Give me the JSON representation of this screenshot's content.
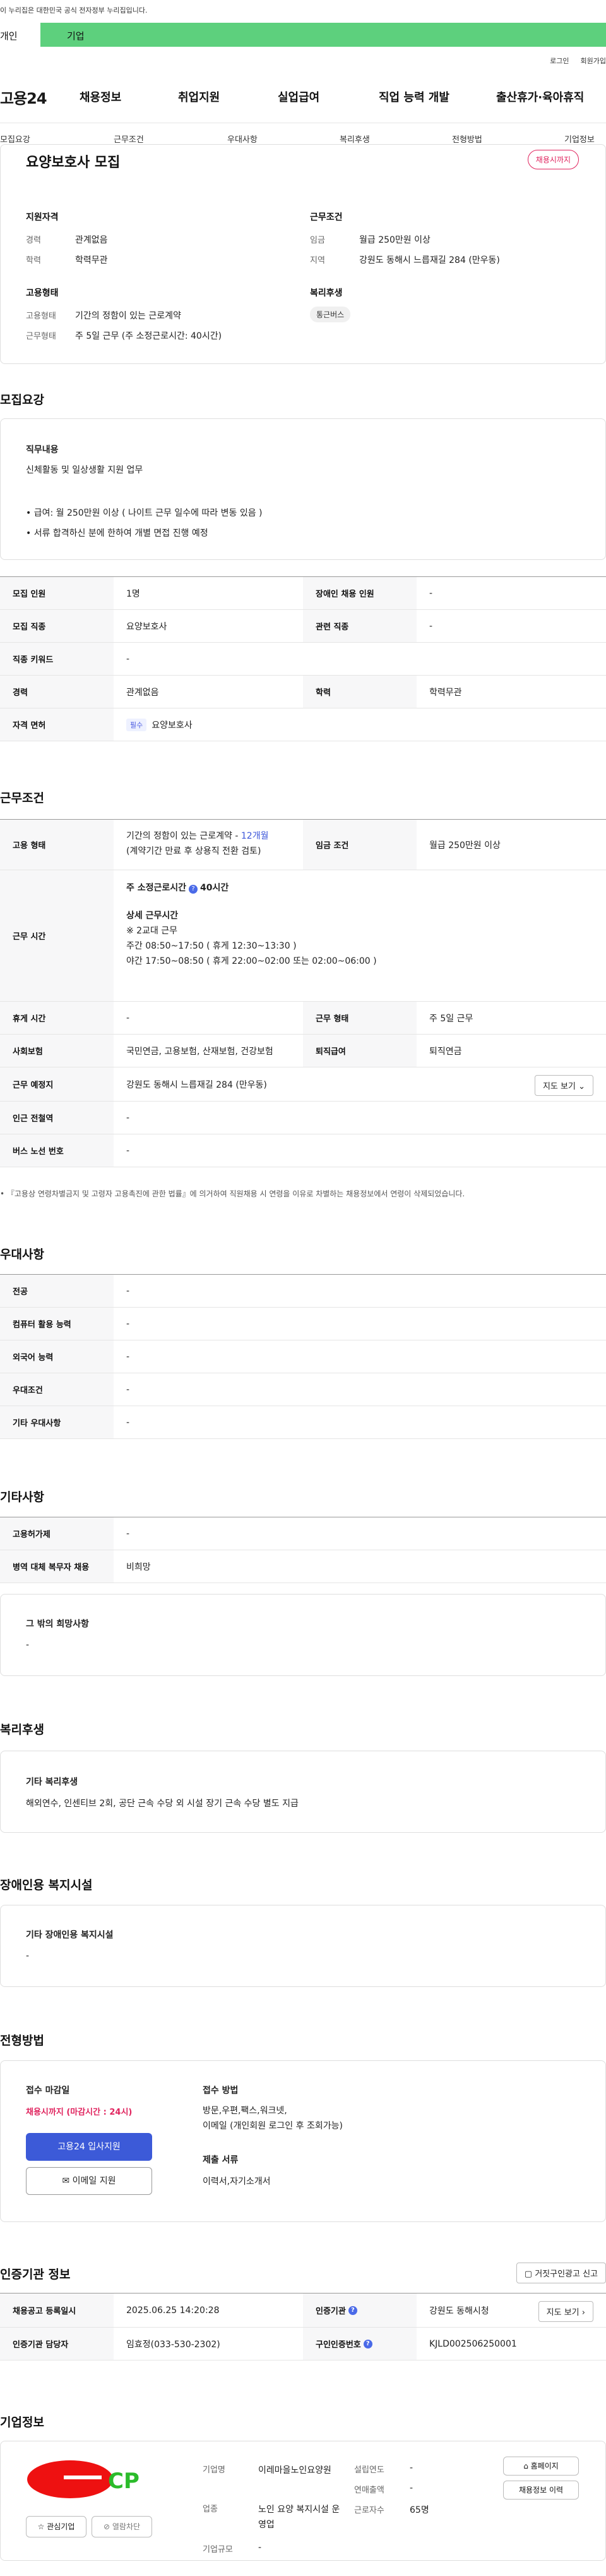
{
  "gov_banner": "이 누리집은 대한민국 공식 전자정부 누리집입니다.",
  "user_tabs": {
    "personal": "개인",
    "company": "기업"
  },
  "top_util": {
    "login": "로그인",
    "join": "회원가입"
  },
  "logo": "고용24",
  "gnb": [
    "채용정보",
    "취업지원",
    "실업급여",
    "직업 능력 개발",
    "출산휴가·육아휴직"
  ],
  "subnav": [
    "모집요강",
    "근무조건",
    "우대사항",
    "복리후생",
    "전형방법",
    "기업정보"
  ],
  "summary": {
    "title": "요양보호사 모집",
    "badge": "채용시까지",
    "support_title": "지원자격",
    "exp_label": "경력",
    "exp": "관계없음",
    "edu_label": "학력",
    "edu": "학력무관",
    "work_title": "근무조건",
    "wage_label": "임금",
    "wage": "월급 250만원 이상",
    "area_label": "지역",
    "area": "강원도 동해시 느릅재길 284 (만우동)",
    "emp_title": "고용형태",
    "emptype_label": "고용형태",
    "emptype": "기간의 정함이 있는 근로계약",
    "worktype_label": "근무형태",
    "worktype": "주 5일 근무 (주 소정근로시간: 40시간)",
    "welfare_title": "복리후생",
    "welfare_chip": "통근버스"
  },
  "recruit": {
    "title": "모집요강",
    "duty_title": "직무내용",
    "duty": "신체활동 및 일상생활 지원 업무",
    "bullet1": "• 급여: 월 250만원 이상 ( 나이트 근무 일수에 따라 변동 있음 )",
    "bullet2": "• 서류 합격하신 분에 한하여 개별 면접 진행 예정",
    "rows": [
      {
        "l": "모집 인원",
        "v": "1명",
        "l2": "장애인 채용 인원",
        "v2": "-"
      },
      {
        "l": "모집 직종",
        "v": "요양보호사",
        "l2": "관련 직종",
        "v2": "-"
      },
      {
        "l": "직종 키워드",
        "v": "-"
      },
      {
        "l": "경력",
        "v": "관계없음",
        "l2": "학력",
        "v2": "학력무관"
      }
    ],
    "license_label": "자격 면허",
    "license_tag": "필수",
    "license": "요양보호사"
  },
  "conditions": {
    "title": "근무조건",
    "emp_label": "고용 형태",
    "emp_line1": "기간의 정함이 있는 근로계약 - ",
    "emp_months": "12개월",
    "emp_line2": "(계약기간 만료 후 상용직 전환 검토)",
    "wage_label": "임금 조건",
    "wage": "월급 250만원 이상",
    "time_label": "근무 시간",
    "time_weekly_label": "주 소정근로시간",
    "time_weekly": "40시간",
    "time_detail_title": "상세 근무시간",
    "time_detail1": "※ 2교대 근무",
    "time_detail2": "주간 08:50~17:50 ( 휴게 12:30~13:30 )",
    "time_detail3": "야간 17:50~08:50 ( 휴게 22:00~02:00 또는 02:00~06:00 )",
    "rest_label": "휴게 시간",
    "rest": "-",
    "form_label": "근무 형태",
    "form": "주 5일 근무",
    "ins_label": "사회보험",
    "ins": "국민연금, 고용보험, 산재보험, 건강보험",
    "pension_label": "퇴직급여",
    "pension": "퇴직연금",
    "place_label": "근무 예정지",
    "place": "강원도 동해시 느릅재길 284 (만우동)",
    "map_btn": "지도 보기",
    "subway_label": "인근 전철역",
    "subway": "-",
    "bus_label": "버스 노선 번호",
    "bus": "-",
    "note": "• 『고용상 연령차별금지 및 고령자 고용촉진에 관한 법률』에 의거하여 직원채용 시 연령을 이유로 차별하는 채용정보에서 연령이 삭제되었습니다."
  },
  "pref": {
    "title": "우대사항",
    "rows": [
      {
        "l": "전공",
        "v": "-"
      },
      {
        "l": "컴퓨터 활용 능력",
        "v": "-"
      },
      {
        "l": "외국어 능력",
        "v": "-"
      },
      {
        "l": "우대조건",
        "v": "-"
      },
      {
        "l": "기타 우대사항",
        "v": "-"
      }
    ]
  },
  "etc": {
    "title": "기타사항",
    "rows": [
      {
        "l": "고용허가제",
        "v": "-"
      },
      {
        "l": "병역 대체 복무자 채용",
        "v": "비희망"
      }
    ],
    "box_title": "그 밖의 희망사항",
    "box_value": "-"
  },
  "welfare": {
    "title": "복리후생",
    "box_title": "기타 복리후생",
    "box_value": "해외연수, 인센티브 2회, 공단 근속 수당 외 시설 장기 근속 수당 별도 지급"
  },
  "disabled": {
    "title": "장애인용 복지시설",
    "box_title": "기타 장애인용 복지시설",
    "box_value": "-"
  },
  "selection": {
    "title": "전형방법",
    "deadline_title": "접수 마감일",
    "deadline": "채용시까지 (마감시간 : 24시)",
    "apply_btn": "고용24 입사지원",
    "email_btn": "이메일 지원",
    "method_title": "접수 방법",
    "method1": "방문,우편,팩스,워크넷,",
    "method2": "이메일 (개인회원 로그인 후 조회가능)",
    "docs_title": "제출 서류",
    "docs": "이력서,자기소개서"
  },
  "cert": {
    "title": "인증기관 정보",
    "report_btn": "거짓구인광고 신고",
    "reg_label": "채용공고 등록일시",
    "reg": "2025.06.25 14:20:28",
    "org_label": "인증기관",
    "org": "강원도 동해시청",
    "map_btn": "지도 보기",
    "mgr_label": "인증기관 담당자",
    "mgr": "임효정(033-530-2302)",
    "id_label": "구인인증번호",
    "id": "KJLD002506250001"
  },
  "company": {
    "title": "기업정보",
    "fav_btn": "관심기업",
    "block_btn": "열람차단",
    "name_label": "기업명",
    "name": "이레마을노인요양원",
    "found_label": "설립연도",
    "found": "-",
    "biz_label": "업종",
    "biz": "노인 요양 복지시설 운영업",
    "sales_label": "연매출액",
    "sales": "-",
    "workers_label": "근로자수",
    "workers": "65명",
    "scale_label": "기업규모",
    "scale": "-",
    "home_btn": "홈페이지",
    "list_btn": "채용정보 이력"
  }
}
